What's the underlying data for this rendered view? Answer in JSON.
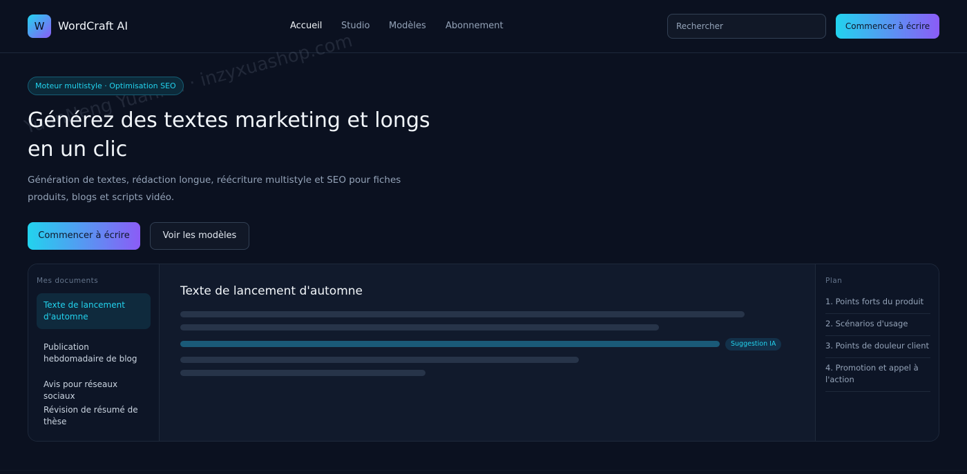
{
  "header": {
    "logo_letter": "W",
    "brand": "WordCraft AI",
    "nav": [
      "Accueil",
      "Studio",
      "Modèles",
      "Abonnement"
    ],
    "active_nav": "Accueil",
    "search": {
      "placeholder": "Rechercher"
    },
    "cta": "Commencer à écrire"
  },
  "hero": {
    "badge": "Moteur multistyle · Optimisation SEO",
    "title": "Générez des textes marketing et longs en un clic",
    "subtitle": "Génération de textes, rédaction longue, réécriture multistyle et SEO pour fiches produits, blogs et scripts vidéo.",
    "primary_button": "Commencer à écrire",
    "secondary_button": "Voir les modèles"
  },
  "workspace": {
    "sidebar_heading": "Mes documents",
    "documents": [
      "Texte de lancement d'automne",
      "Publication hebdomadaire de blog",
      "Avis pour réseaux sociaux",
      "Révision de résumé de thèse"
    ],
    "active_document": "Texte de lancement d'automne",
    "editor_title": "Texte de lancement d'automne",
    "ai_chip": "Suggestion IA",
    "outline_heading": "Plan",
    "outline": [
      "1. Points forts du produit",
      "2. Scénarios d'usage",
      "3. Points de douleur client",
      "4. Promotion et appel à l'action"
    ]
  },
  "watermark": "YuanNeng YuanMa · inzyxuashop.com",
  "colors": {
    "background": "#0b1120",
    "accent_cyan": "#22d3ee",
    "accent_violet": "#8b5cf6",
    "panel": "#0f172a"
  }
}
